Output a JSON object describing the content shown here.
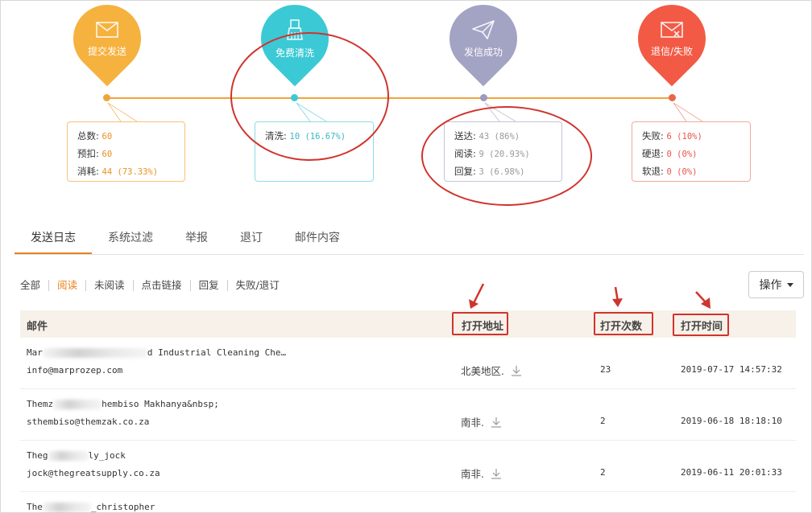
{
  "stages": [
    {
      "label": "提交发送",
      "color": "#f6b23e",
      "dot": "#f0a33b",
      "icon": "mail-icon"
    },
    {
      "label": "免费清洗",
      "color": "#3bc9d6",
      "dot": "#3bc9d6",
      "icon": "broom-icon"
    },
    {
      "label": "发信成功",
      "color": "#a3a3c4",
      "dot": "#9b9bbd",
      "icon": "paper-plane-icon"
    },
    {
      "label": "退信/失败",
      "color": "#f25a45",
      "dot": "#e8664d",
      "icon": "mail-x-icon"
    }
  ],
  "boxes": {
    "submit": [
      {
        "k": "总数:",
        "v": "60"
      },
      {
        "k": "预扣:",
        "v": "60"
      },
      {
        "k": "消耗:",
        "v": "44 (73.33%)"
      }
    ],
    "clean": [
      {
        "k": "清洗:",
        "v": "10 (16.67%)"
      }
    ],
    "success": [
      {
        "k": "送达:",
        "v": "43 (86%)"
      },
      {
        "k": "阅读:",
        "v": "9 (20.93%)"
      },
      {
        "k": "回复:",
        "v": "3 (6.98%)"
      }
    ],
    "fail": [
      {
        "k": "失败:",
        "v": "6 (10%)"
      },
      {
        "k": "硬退:",
        "v": "0 (0%)"
      },
      {
        "k": "软退:",
        "v": "0 (0%)"
      }
    ]
  },
  "tabs": [
    "发送日志",
    "系统过滤",
    "举报",
    "退订",
    "邮件内容"
  ],
  "filters": [
    "全部",
    "阅读",
    "未阅读",
    "点击链接",
    "回复",
    "失败/退订"
  ],
  "op_button": "操作",
  "table": {
    "headers": {
      "mail": "邮件",
      "addr": "打开地址",
      "count": "打开次数",
      "time": "打开时间"
    },
    "rows": [
      {
        "name_a": "Mar",
        "name_b": "d Industrial Cleaning Che…",
        "email": "info@marprozep.com",
        "loc": "北美地区.",
        "count": "23",
        "time": "2019-07-17 14:57:32"
      },
      {
        "name_a": "Themz",
        "name_b": "hembiso Makhanya&nbsp;",
        "email": "sthembiso@themzak.co.za",
        "loc": "南非.",
        "count": "2",
        "time": "2019-06-18 18:18:10"
      },
      {
        "name_a": "Theg",
        "name_b": "ly_jock",
        "email": "jock@thegreatsupply.co.za",
        "loc": "南非.",
        "count": "2",
        "time": "2019-06-11 20:01:33"
      },
      {
        "name_a": "The",
        "name_b": "_christopher",
        "email": "",
        "loc": "",
        "count": "",
        "time": ""
      }
    ]
  }
}
